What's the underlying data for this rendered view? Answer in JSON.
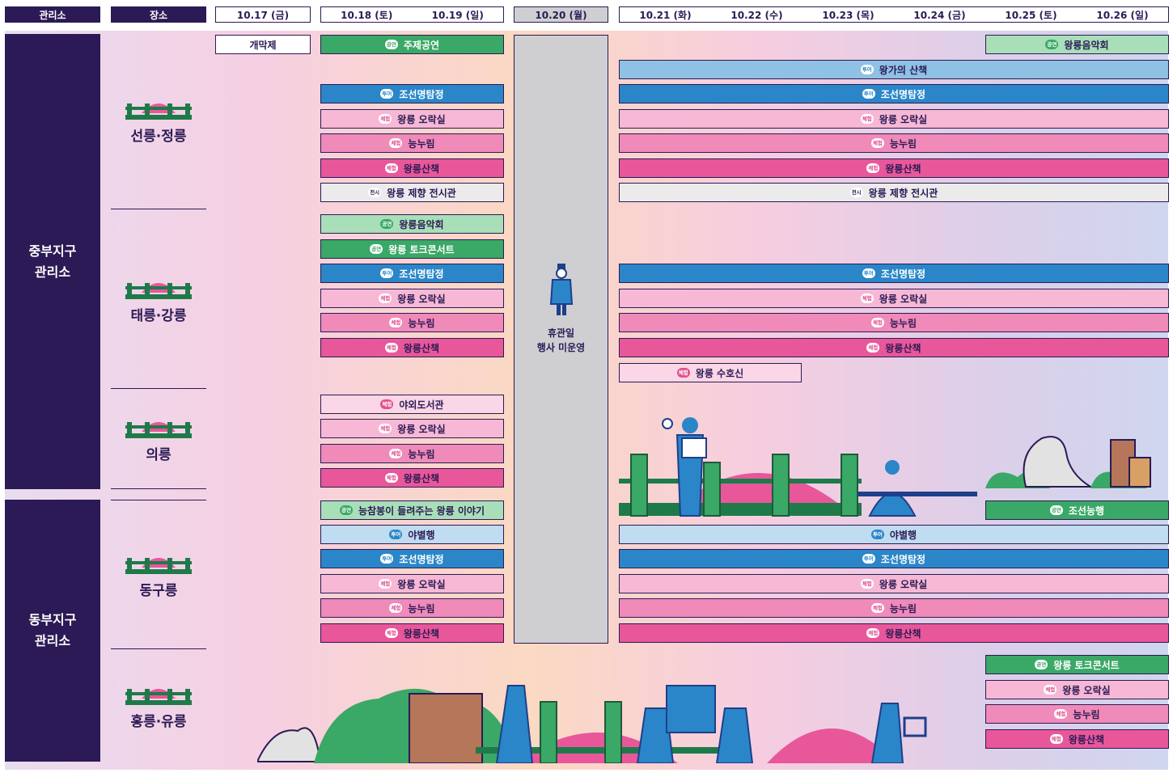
{
  "header": {
    "office_col": "관리소",
    "place_col": "장소",
    "days": [
      "10.17 (금)",
      "10.18 (토)",
      "10.19 (일)",
      "10.20 (월)",
      "10.21 (화)",
      "10.22 (수)",
      "10.23 (목)",
      "10.24 (금)",
      "10.25 (토)",
      "10.26 (일)"
    ]
  },
  "offices": [
    "중부지구\n관리소",
    "동부지구\n관리소"
  ],
  "places": [
    "선릉·정릉",
    "태릉·강릉",
    "의릉",
    "동구릉",
    "홍릉·유릉"
  ],
  "closed_day": {
    "text": "휴관일\n행사 미운영"
  },
  "badges": {
    "perf": "공연",
    "tour": "투어",
    "exp": "체험",
    "exh": "전시"
  },
  "events": {
    "opening": "개막제",
    "main_show": "주제공연",
    "royal_concert": "왕릉음악회",
    "royal_walk_tour": "왕가의 산책",
    "detective": "조선명탐정",
    "royal_game_room": "왕릉 오락실",
    "neungnurim": "능누림",
    "royal_stroll": "왕릉산책",
    "ritual_hall": "왕릉 제향 전시관",
    "talk_concert": "왕릉 토크콘서트",
    "guardian_deity": "왕릉 수호신",
    "outdoor_library": "야외도서관",
    "story": "능참봉이 들려주는 왕릉 이야기",
    "night_walk": "야별행",
    "joseon_tomb": "조선능행"
  },
  "colors": {
    "navy": "#2b1a55",
    "green": "#3aa866",
    "blue": "#2a86c8",
    "pink": "#e8579a",
    "gray": "#cfcfd2"
  }
}
